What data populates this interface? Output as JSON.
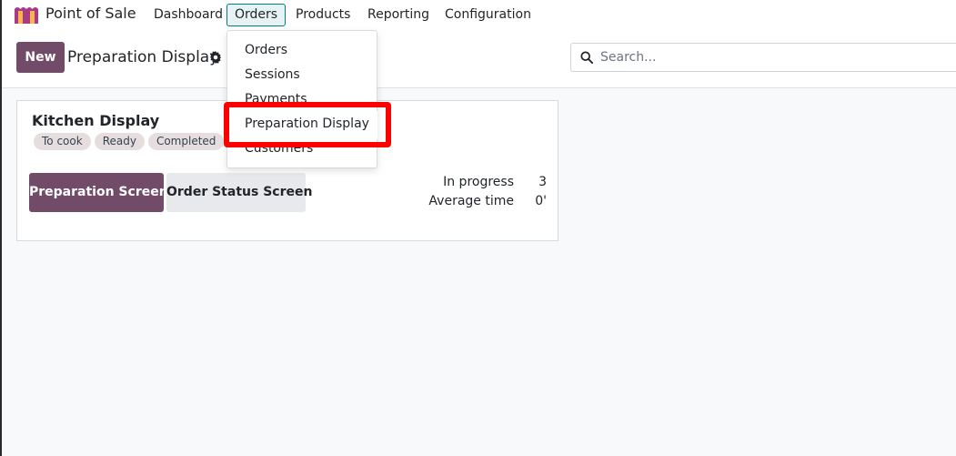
{
  "navbar": {
    "app_name": "Point of Sale",
    "menu": [
      "Dashboard",
      "Orders",
      "Products",
      "Reporting",
      "Configuration"
    ],
    "active": "Orders"
  },
  "control_panel": {
    "new_label": "New",
    "title": "Preparation Display",
    "search_placeholder": "Search..."
  },
  "orders_dropdown": {
    "items": [
      "Orders",
      "Sessions",
      "Payments",
      "Preparation Display",
      "Customers"
    ],
    "highlighted": "Preparation Display"
  },
  "card": {
    "title": "Kitchen Display",
    "tags": [
      "To cook",
      "Ready",
      "Completed"
    ],
    "primary_button": "Preparation Screen",
    "secondary_button": "Order Status Screen",
    "stats": [
      {
        "label": "In progress",
        "value": "3"
      },
      {
        "label": "Average time",
        "value": "0'"
      }
    ]
  },
  "colors": {
    "brand": "#714b67",
    "nav_active_border": "#017e84",
    "annotation": "#ff0000"
  }
}
